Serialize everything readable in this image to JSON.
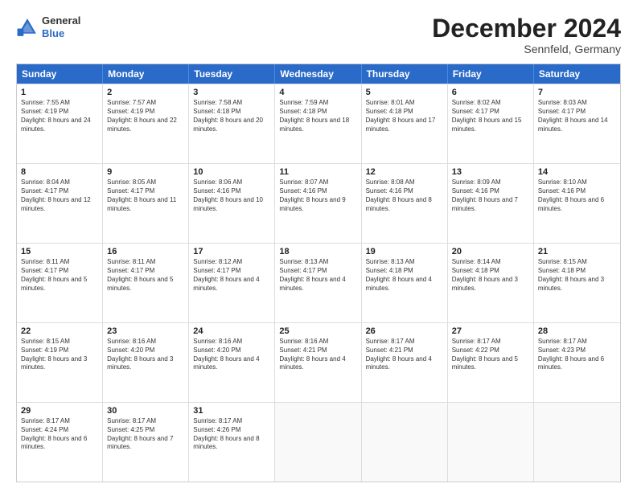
{
  "header": {
    "logo_line1": "General",
    "logo_line2": "Blue",
    "month": "December 2024",
    "location": "Sennfeld, Germany"
  },
  "days_of_week": [
    "Sunday",
    "Monday",
    "Tuesday",
    "Wednesday",
    "Thursday",
    "Friday",
    "Saturday"
  ],
  "weeks": [
    [
      {
        "day": "1",
        "sunrise": "7:55 AM",
        "sunset": "4:19 PM",
        "daylight": "8 hours and 24 minutes."
      },
      {
        "day": "2",
        "sunrise": "7:57 AM",
        "sunset": "4:19 PM",
        "daylight": "8 hours and 22 minutes."
      },
      {
        "day": "3",
        "sunrise": "7:58 AM",
        "sunset": "4:18 PM",
        "daylight": "8 hours and 20 minutes."
      },
      {
        "day": "4",
        "sunrise": "7:59 AM",
        "sunset": "4:18 PM",
        "daylight": "8 hours and 18 minutes."
      },
      {
        "day": "5",
        "sunrise": "8:01 AM",
        "sunset": "4:18 PM",
        "daylight": "8 hours and 17 minutes."
      },
      {
        "day": "6",
        "sunrise": "8:02 AM",
        "sunset": "4:17 PM",
        "daylight": "8 hours and 15 minutes."
      },
      {
        "day": "7",
        "sunrise": "8:03 AM",
        "sunset": "4:17 PM",
        "daylight": "8 hours and 14 minutes."
      }
    ],
    [
      {
        "day": "8",
        "sunrise": "8:04 AM",
        "sunset": "4:17 PM",
        "daylight": "8 hours and 12 minutes."
      },
      {
        "day": "9",
        "sunrise": "8:05 AM",
        "sunset": "4:17 PM",
        "daylight": "8 hours and 11 minutes."
      },
      {
        "day": "10",
        "sunrise": "8:06 AM",
        "sunset": "4:16 PM",
        "daylight": "8 hours and 10 minutes."
      },
      {
        "day": "11",
        "sunrise": "8:07 AM",
        "sunset": "4:16 PM",
        "daylight": "8 hours and 9 minutes."
      },
      {
        "day": "12",
        "sunrise": "8:08 AM",
        "sunset": "4:16 PM",
        "daylight": "8 hours and 8 minutes."
      },
      {
        "day": "13",
        "sunrise": "8:09 AM",
        "sunset": "4:16 PM",
        "daylight": "8 hours and 7 minutes."
      },
      {
        "day": "14",
        "sunrise": "8:10 AM",
        "sunset": "4:16 PM",
        "daylight": "8 hours and 6 minutes."
      }
    ],
    [
      {
        "day": "15",
        "sunrise": "8:11 AM",
        "sunset": "4:17 PM",
        "daylight": "8 hours and 5 minutes."
      },
      {
        "day": "16",
        "sunrise": "8:11 AM",
        "sunset": "4:17 PM",
        "daylight": "8 hours and 5 minutes."
      },
      {
        "day": "17",
        "sunrise": "8:12 AM",
        "sunset": "4:17 PM",
        "daylight": "8 hours and 4 minutes."
      },
      {
        "day": "18",
        "sunrise": "8:13 AM",
        "sunset": "4:17 PM",
        "daylight": "8 hours and 4 minutes."
      },
      {
        "day": "19",
        "sunrise": "8:13 AM",
        "sunset": "4:18 PM",
        "daylight": "8 hours and 4 minutes."
      },
      {
        "day": "20",
        "sunrise": "8:14 AM",
        "sunset": "4:18 PM",
        "daylight": "8 hours and 3 minutes."
      },
      {
        "day": "21",
        "sunrise": "8:15 AM",
        "sunset": "4:18 PM",
        "daylight": "8 hours and 3 minutes."
      }
    ],
    [
      {
        "day": "22",
        "sunrise": "8:15 AM",
        "sunset": "4:19 PM",
        "daylight": "8 hours and 3 minutes."
      },
      {
        "day": "23",
        "sunrise": "8:16 AM",
        "sunset": "4:20 PM",
        "daylight": "8 hours and 3 minutes."
      },
      {
        "day": "24",
        "sunrise": "8:16 AM",
        "sunset": "4:20 PM",
        "daylight": "8 hours and 4 minutes."
      },
      {
        "day": "25",
        "sunrise": "8:16 AM",
        "sunset": "4:21 PM",
        "daylight": "8 hours and 4 minutes."
      },
      {
        "day": "26",
        "sunrise": "8:17 AM",
        "sunset": "4:21 PM",
        "daylight": "8 hours and 4 minutes."
      },
      {
        "day": "27",
        "sunrise": "8:17 AM",
        "sunset": "4:22 PM",
        "daylight": "8 hours and 5 minutes."
      },
      {
        "day": "28",
        "sunrise": "8:17 AM",
        "sunset": "4:23 PM",
        "daylight": "8 hours and 6 minutes."
      }
    ],
    [
      {
        "day": "29",
        "sunrise": "8:17 AM",
        "sunset": "4:24 PM",
        "daylight": "8 hours and 6 minutes."
      },
      {
        "day": "30",
        "sunrise": "8:17 AM",
        "sunset": "4:25 PM",
        "daylight": "8 hours and 7 minutes."
      },
      {
        "day": "31",
        "sunrise": "8:17 AM",
        "sunset": "4:26 PM",
        "daylight": "8 hours and 8 minutes."
      },
      null,
      null,
      null,
      null
    ]
  ],
  "labels": {
    "sunrise": "Sunrise:",
    "sunset": "Sunset:",
    "daylight": "Daylight:"
  }
}
